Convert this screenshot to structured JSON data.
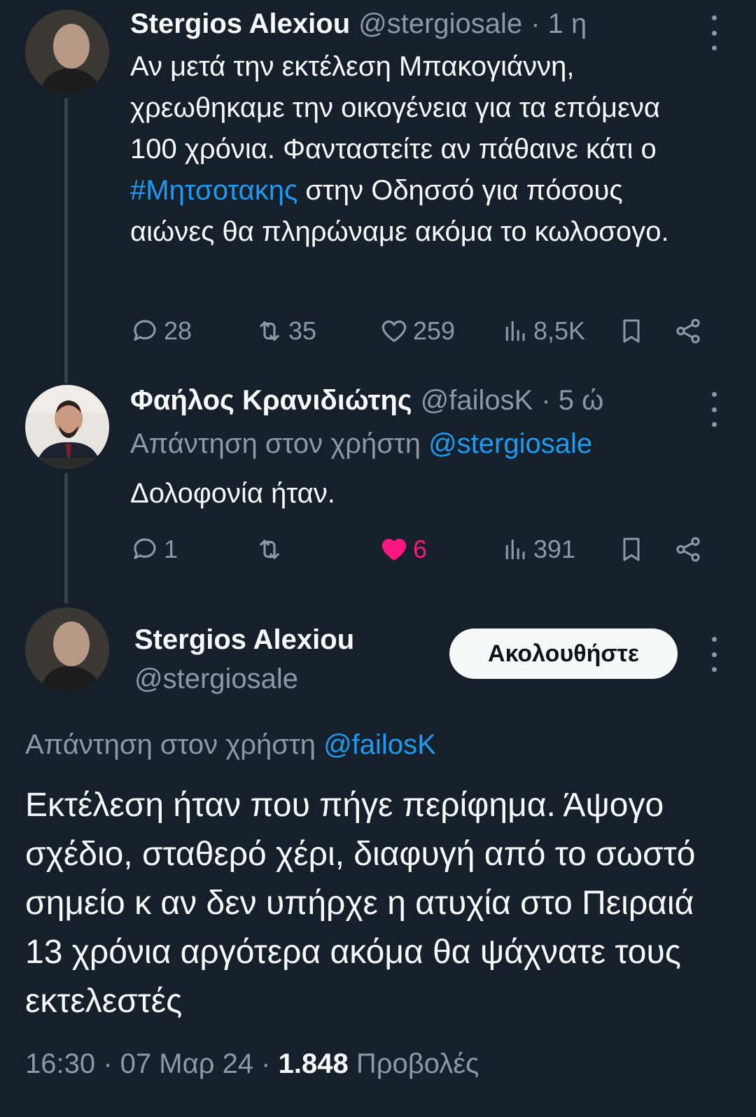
{
  "tweet1": {
    "author_name": "Stergios Alexiou",
    "handle": "@stergiosale",
    "time": "· 1 η",
    "text_parts": [
      "Αν μετά την εκτέλεση Μπακογιάννη, χρεωθηκαμε την οικογένεια για τα επόμενα 100 χρόνια. Φανταστείτε αν πάθαινε κάτι ο ",
      "#Μητσοτακης",
      " στην Οδησσό για πόσους αιώνες θα πληρώναμε ακόμα το κωλοσογο."
    ],
    "actions": {
      "replies": "28",
      "retweets": "35",
      "likes": "259",
      "views": "8,5K"
    }
  },
  "tweet2": {
    "author_name": "Φαήλος Κρανιδιώτης",
    "handle": "@failosK",
    "time": "· 5 ώ",
    "reply_prefix": "Απάντηση στον χρήστη",
    "reply_to": "@stergiosale",
    "text": "Δολοφονία ήταν.",
    "actions": {
      "replies": "1",
      "retweets": "",
      "likes": "6",
      "views": "391"
    },
    "liked": true
  },
  "main_tweet": {
    "author_name": "Stergios Alexiou",
    "handle": "@stergiosale",
    "follow_label": "Ακολουθήστε",
    "reply_prefix": "Απάντηση στον χρήστη",
    "reply_to": "@failosK",
    "text": "Εκτέλεση ήταν που πήγε περίφημα. Άψογο σχέδιο, σταθερό χέρι, διαφυγή από το σωστό σημείο κ αν δεν υπήρχε η ατυχία στο Πειραιά 13 χρόνια αργότερα ακόμα θα ψάχνατε τους εκτελεστές",
    "time": "16:30 · 07 Μαρ 24 · ",
    "views_count": "1.848",
    "views_label": " Προβολές"
  },
  "colors": {
    "background": "#15202b",
    "link": "#1d9bf0",
    "like_active": "#f91880",
    "muted": "#8b98a5"
  }
}
